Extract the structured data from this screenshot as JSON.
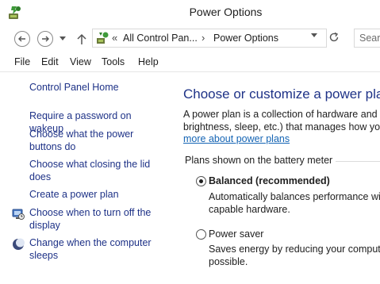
{
  "window": {
    "title": "Power Options",
    "app_icon": "power-options-icon"
  },
  "nav": {
    "back_icon": "back-arrow-icon",
    "forward_icon": "forward-arrow-icon",
    "up_icon": "up-arrow-icon",
    "address": {
      "icon": "control-panel-icon",
      "overflow": "«",
      "crumbs": [
        "All Control Pan...",
        "Power Options"
      ],
      "separator": "›"
    },
    "refresh_icon": "refresh-icon",
    "search_placeholder": "Searc"
  },
  "menu": [
    "File",
    "Edit",
    "View",
    "Tools",
    "Help"
  ],
  "sidebar": {
    "home": "Control Panel Home",
    "links": [
      {
        "label": [
          "Require a password on wakeup"
        ]
      },
      {
        "label": [
          "Choose what the power",
          "buttons do"
        ]
      },
      {
        "label": [
          "Choose what closing the lid",
          "does"
        ]
      },
      {
        "label": [
          "Create a power plan"
        ]
      },
      {
        "label": [
          "Choose when to turn off the",
          "display"
        ],
        "icon": "display-icon"
      },
      {
        "label": [
          "Change when the computer",
          "sleeps"
        ],
        "icon": "sleep-moon-icon"
      }
    ]
  },
  "main": {
    "title": "Choose or customize a power plan",
    "intro_lines": [
      "A power plan is a collection of hardware and sy",
      "brightness, sleep, etc.) that manages how your"
    ],
    "intro_link": "more about power plans",
    "group_label": "Plans shown on the battery meter",
    "plans": [
      {
        "name": "Balanced (recommended)",
        "selected": true,
        "desc": [
          "Automatically balances performance wit",
          "capable hardware."
        ]
      },
      {
        "name": "Power saver",
        "selected": false,
        "desc": [
          "Saves energy by reducing your computer",
          "possible."
        ]
      }
    ]
  },
  "colors": {
    "link": "#1e3287",
    "hyperlink": "#1464b4",
    "title": "#1e3287"
  }
}
